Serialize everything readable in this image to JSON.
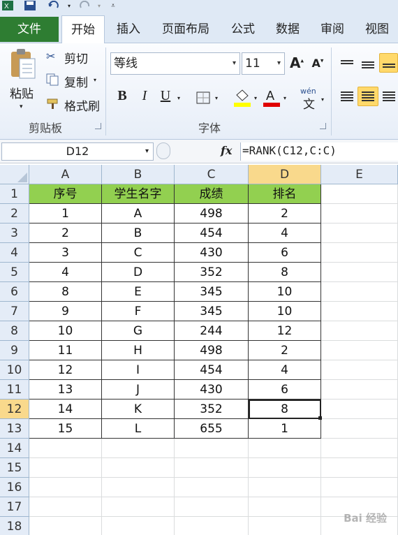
{
  "quick_access": {
    "icons": [
      "excel-icon",
      "save-icon",
      "undo-icon",
      "redo-icon",
      "customize-icon"
    ]
  },
  "tabs": [
    {
      "label": "文件"
    },
    {
      "label": "开始"
    },
    {
      "label": "插入"
    },
    {
      "label": "页面布局"
    },
    {
      "label": "公式"
    },
    {
      "label": "数据"
    },
    {
      "label": "审阅"
    },
    {
      "label": "视图"
    }
  ],
  "ribbon": {
    "clipboard": {
      "paste": "粘贴",
      "cut": "剪切",
      "copy": "复制",
      "format_painter": "格式刷",
      "group_label": "剪贴板"
    },
    "font": {
      "name": "等线",
      "size": "11",
      "bold": "B",
      "italic": "I",
      "underline": "U",
      "group_label": "字体",
      "phonetic": "wén",
      "phonetic_char": "文"
    }
  },
  "formula_bar": {
    "name_box": "D12",
    "fx": "fx",
    "formula": "=RANK(C12,C:C)"
  },
  "sheet": {
    "columns": [
      "A",
      "B",
      "C",
      "D",
      "E"
    ],
    "rows": [
      "1",
      "2",
      "3",
      "4",
      "5",
      "6",
      "7",
      "8",
      "9",
      "10",
      "11",
      "12",
      "13",
      "14",
      "15",
      "16",
      "17",
      "18"
    ],
    "selected_cell": "D12",
    "header_fill": "#92d050",
    "headers": [
      "序号",
      "学生名字",
      "成绩",
      "排名"
    ],
    "data": [
      [
        "1",
        "A",
        "498",
        "2"
      ],
      [
        "2",
        "B",
        "454",
        "4"
      ],
      [
        "3",
        "C",
        "430",
        "6"
      ],
      [
        "4",
        "D",
        "352",
        "8"
      ],
      [
        "8",
        "E",
        "345",
        "10"
      ],
      [
        "9",
        "F",
        "345",
        "10"
      ],
      [
        "10",
        "G",
        "244",
        "12"
      ],
      [
        "11",
        "H",
        "498",
        "2"
      ],
      [
        "12",
        "I",
        "454",
        "4"
      ],
      [
        "13",
        "J",
        "430",
        "6"
      ],
      [
        "14",
        "K",
        "352",
        "8"
      ],
      [
        "15",
        "L",
        "655",
        "1"
      ]
    ]
  },
  "watermark": "Bai 经验"
}
